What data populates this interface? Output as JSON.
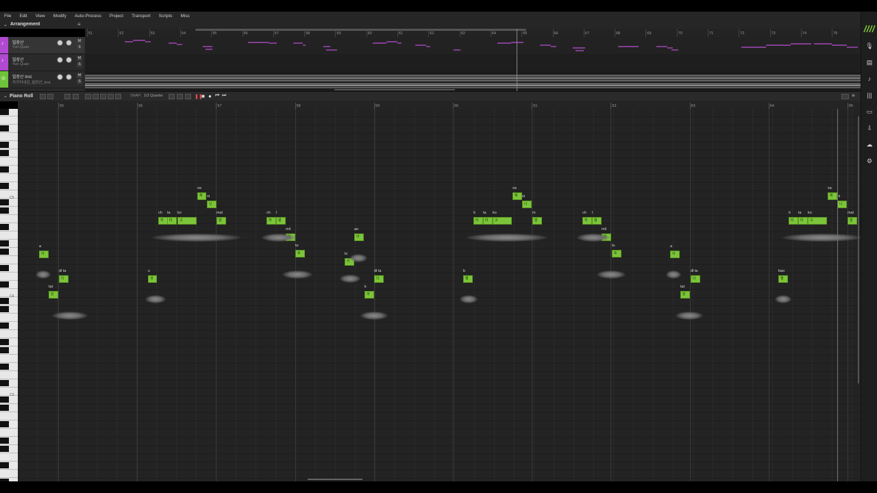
{
  "menu": [
    "File",
    "Edit",
    "View",
    "Modify",
    "Auto-Process",
    "Project",
    "Transport",
    "Scripts",
    "Misc"
  ],
  "arrangement": {
    "title": "Arrangement",
    "ruler": [
      "51",
      "52",
      "53",
      "54",
      "55",
      "56",
      "57",
      "58",
      "59",
      "60",
      "61",
      "62",
      "63",
      "64",
      "65",
      "66",
      "67",
      "68",
      "69",
      "70",
      "71",
      "72",
      "73",
      "74",
      "75"
    ],
    "tracks": [
      {
        "name": "빌장산",
        "sub": "Yun Quan",
        "color": "#b04ad1",
        "mute": "M",
        "solo": "S"
      },
      {
        "name": "빌장산",
        "sub": "Yun Quan",
        "color": "#b04ad1",
        "mute": "M",
        "solo": "S"
      },
      {
        "name": "빌장산 Inst.",
        "sub": "카가미내관_빌장산_Inst",
        "color": "#6fc23a",
        "mute": "M",
        "solo": "S"
      }
    ]
  },
  "piano_roll": {
    "title": "Piano Roll",
    "snap_label": "SNAP:",
    "snap_value": "1/2 Quarter",
    "ruler": [
      "55",
      "56",
      "57",
      "58",
      "59",
      "60",
      "61",
      "62",
      "63",
      "64",
      "65"
    ],
    "key_labels": [
      "C5",
      "C4",
      "C3"
    ],
    "notes": [
      {
        "lyric": "a",
        "glyph": "아"
      },
      {
        "lyric": "tat",
        "glyph": "닫"
      },
      {
        "lyric": "dl ta",
        "glyph": "다"
      },
      {
        "lyric": "s",
        "glyph": "생"
      },
      {
        "lyric": "ch",
        "glyph": "처"
      },
      {
        "lyric": "ta",
        "glyph": "타"
      },
      {
        "lyric": "ko",
        "glyph": "고"
      },
      {
        "lyric": "xa",
        "glyph": "해"
      },
      {
        "lyric": "ni",
        "glyph": "닌"
      },
      {
        "lyric": "mal",
        "glyph": "말"
      },
      {
        "lyric": "ch",
        "glyph": "처"
      },
      {
        "lyric": "l",
        "glyph": "럼"
      },
      {
        "lyric": "mil",
        "glyph": "밀"
      },
      {
        "lyric": "to",
        "glyph": "토"
      },
      {
        "lyric": "ao",
        "glyph": "아"
      },
      {
        "lyric": "ki",
        "glyph": "키"
      },
      {
        "lyric": "k",
        "glyph": "까"
      },
      {
        "lyric": "dl ta",
        "glyph": "다"
      },
      {
        "lyric": "b",
        "glyph": "별"
      },
      {
        "lyric": "ti",
        "glyph": "티"
      },
      {
        "lyric": "ta",
        "glyph": "타"
      },
      {
        "lyric": "ko",
        "glyph": "고"
      },
      {
        "lyric": "xa",
        "glyph": "해"
      },
      {
        "lyric": "ni",
        "glyph": "니"
      },
      {
        "lyric": "m",
        "glyph": "말"
      },
      {
        "lyric": "ch",
        "glyph": "처"
      },
      {
        "lyric": "l",
        "glyph": "럼"
      },
      {
        "lyric": "mil",
        "glyph": "밀"
      },
      {
        "lyric": "to",
        "glyph": "토"
      },
      {
        "lyric": "a",
        "glyph": "아"
      },
      {
        "lyric": "tat",
        "glyph": "닫"
      },
      {
        "lyric": "dl ta",
        "glyph": "다"
      },
      {
        "lyric": "bao",
        "glyph": "별"
      },
      {
        "lyric": "ti",
        "glyph": "티"
      },
      {
        "lyric": "ta",
        "glyph": "타"
      },
      {
        "lyric": "ko",
        "glyph": "고"
      },
      {
        "lyric": "xa",
        "glyph": "해"
      },
      {
        "lyric": "ni",
        "glyph": "니"
      },
      {
        "lyric": "mal",
        "glyph": "말"
      }
    ]
  },
  "colors": {
    "accent": "#7cc43a",
    "purple": "#b04ad1",
    "bg": "#232323"
  }
}
